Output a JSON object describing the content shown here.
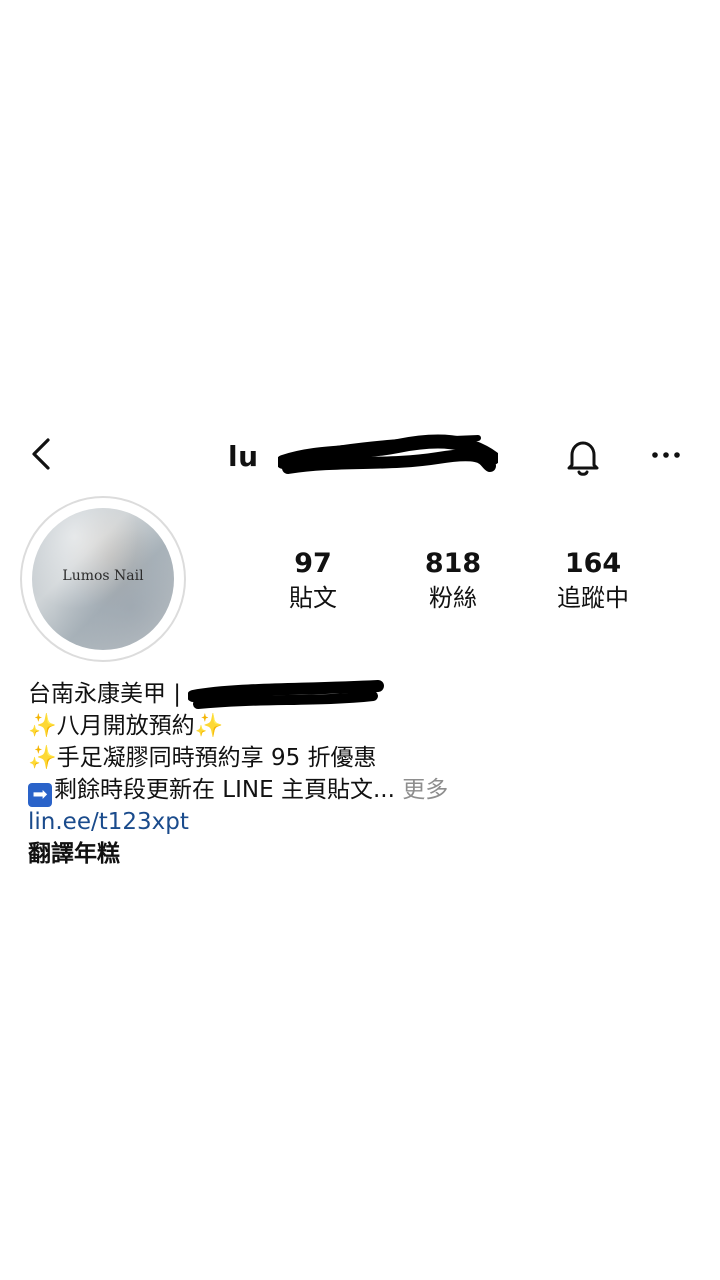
{
  "header": {
    "username": "lu",
    "back_icon": "chevron-left-icon",
    "bell_icon": "bell-icon",
    "more_icon": "more-horizontal-icon"
  },
  "profile": {
    "avatar_text": "Lumos Nail",
    "stats": [
      {
        "value": "97",
        "label": "貼文"
      },
      {
        "value": "818",
        "label": "粉絲"
      },
      {
        "value": "164",
        "label": "追蹤中"
      }
    ]
  },
  "bio": {
    "name": "台南永康美甲 |",
    "line1_sparkle_left": "✨",
    "line1_text": "八月開放預約",
    "line1_sparkle_right": "✨",
    "line2_sparkle": "✨",
    "line2_text": "手足凝膠同時預約享 95 折優惠",
    "line3_arrow": "➡",
    "line3_text": "剩餘時段更新在 LINE 主頁貼文...",
    "more": " 更多",
    "link": "lin.ee/t123xpt",
    "translate": "翻譯年糕"
  },
  "colors": {
    "link": "#1a4b8c",
    "muted": "#8e8e8e",
    "sparkle": "#f4c33a",
    "arrow_box": "#2a63c9"
  }
}
